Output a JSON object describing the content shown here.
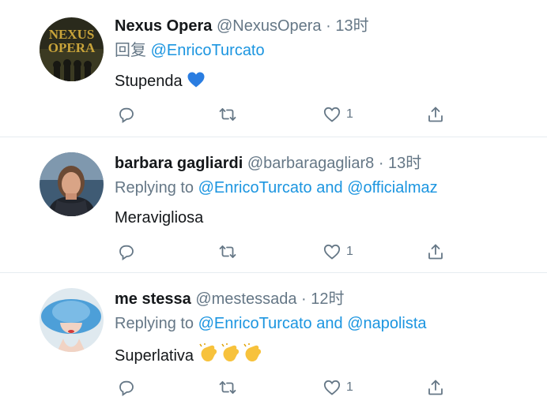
{
  "tweets": [
    {
      "name": "Nexus Opera",
      "handle": "@NexusOpera",
      "dot": "·",
      "time": "13时",
      "reply_prefix": "回复",
      "reply_mentions": [
        "@EnricoTurcato"
      ],
      "reply_join": "",
      "text": "Stupenda",
      "emoji": "blue-heart",
      "like_count": "1",
      "avatar_text": "NEXUS OPERA"
    },
    {
      "name": "barbara gagliardi",
      "handle": "@barbaragagliar8",
      "dot": "·",
      "time": "13时",
      "reply_prefix": "Replying to",
      "reply_mentions": [
        "@EnricoTurcato",
        "@officialmaz"
      ],
      "reply_join": "and",
      "text": "Meravigliosa",
      "emoji": "",
      "like_count": "1"
    },
    {
      "name": "me stessa",
      "handle": "@mestessada",
      "dot": "·",
      "time": "12时",
      "reply_prefix": "Replying to",
      "reply_mentions": [
        "@EnricoTurcato",
        "@napolista"
      ],
      "reply_join": "and",
      "text": "Superlativa",
      "emoji": "clapping-hands x3",
      "like_count": "1"
    }
  ],
  "colors": {
    "accent": "#1b95e0",
    "muted": "#657786",
    "text": "#14171a",
    "divider": "#e6ecf0"
  }
}
